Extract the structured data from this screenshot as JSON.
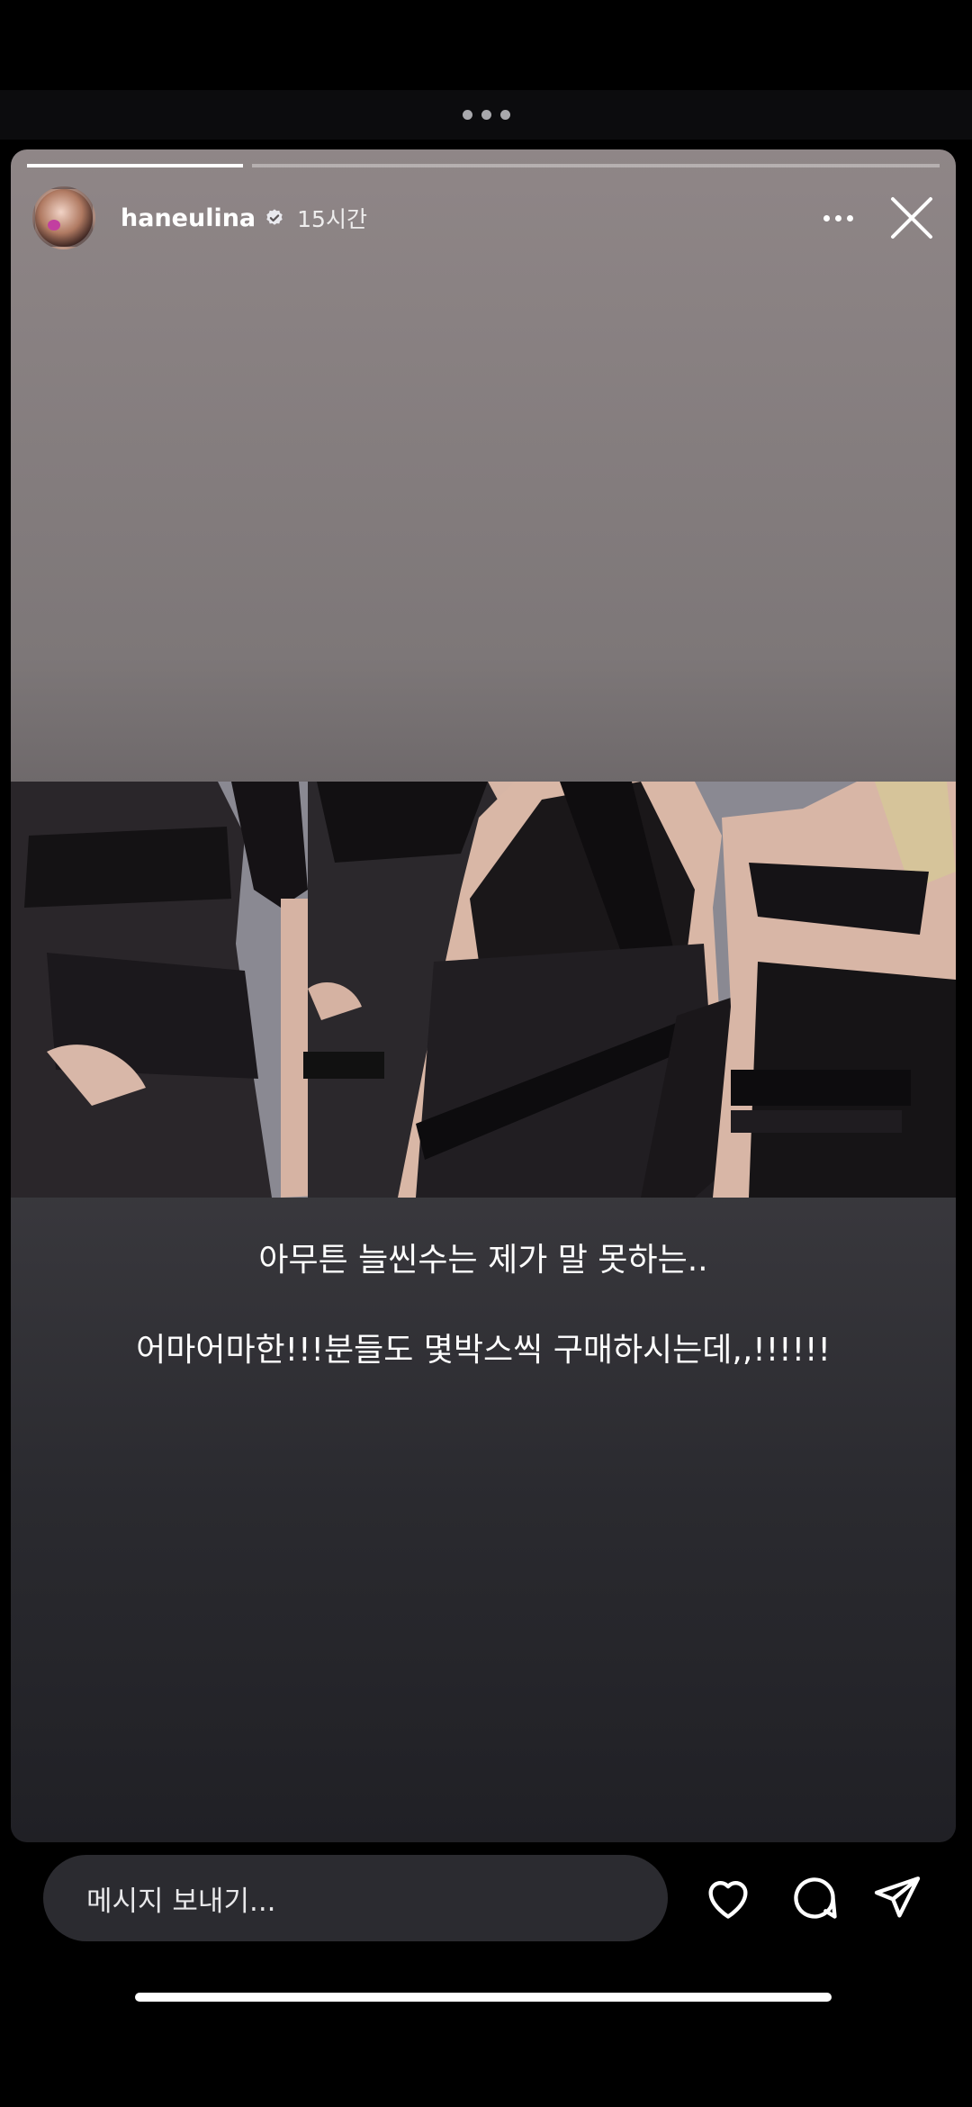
{
  "story": {
    "username": "haneulina",
    "timestamp": "15시간",
    "caption_line1": "아무튼 늘씬수는 제가 말 못하는..",
    "caption_line2": "어마어마한!!!분들도 몇박스씩 구매하시는데,,!!!!!!"
  },
  "footer": {
    "message_placeholder": "메시지 보내기..."
  },
  "icons": {
    "verified": "verified-badge-icon",
    "more": "more-dots-icon",
    "close": "close-icon",
    "like": "heart-icon",
    "comment": "comment-bubble-icon",
    "share": "send-paper-plane-icon"
  },
  "colors": {
    "background": "#000000",
    "input_background": "#2b2b30",
    "progress_active": "#ffffff"
  }
}
